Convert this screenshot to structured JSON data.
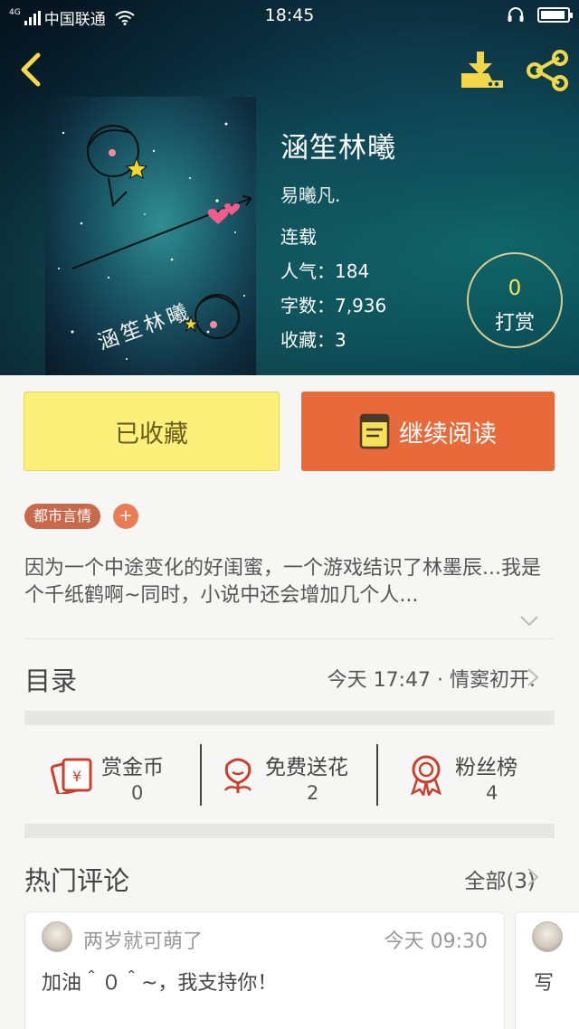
{
  "status_bar": {
    "network": "4G",
    "carrier": "中国联通",
    "time": "18:45"
  },
  "book": {
    "cover_title": "涵笙林曦",
    "title": "涵笙林曦",
    "author": "易曦凡.",
    "status": "连载",
    "popularity_label": "人气：",
    "popularity": "184",
    "words_label": "字数：",
    "words": "7,936",
    "favorites_label": "收藏：",
    "favorites": "3"
  },
  "reward": {
    "count": "0",
    "label": "打赏"
  },
  "actions": {
    "collected": "已收藏",
    "continue_reading": "继续阅读"
  },
  "tag": {
    "label": "都市言情",
    "add": "+"
  },
  "synopsis": "因为一个中途变化的好闺蜜，一个游戏结识了林墨辰...我是个千纸鹤啊~同时，小说中还会增加几个人...",
  "toc": {
    "label": "目录",
    "latest": "今天 17:47 · 情窦初开."
  },
  "fund": [
    {
      "label": "赏金币",
      "value": "0"
    },
    {
      "label": "免费送花",
      "value": "2"
    },
    {
      "label": "粉丝榜",
      "value": "4"
    }
  ],
  "comments": {
    "title": "热门评论",
    "all": "全部(3)",
    "items": [
      {
        "user": "两岁就可萌了",
        "time": "今天 09:30",
        "text": "加油＾０＾~，我支持你！"
      },
      {
        "text": "写"
      }
    ]
  },
  "colors": {
    "accent_yellow": "#fbf07a",
    "accent_orange": "#e8693a",
    "tag": "#c8694c",
    "icon_red": "#c9402e",
    "icon_gold": "#f0d63c"
  }
}
